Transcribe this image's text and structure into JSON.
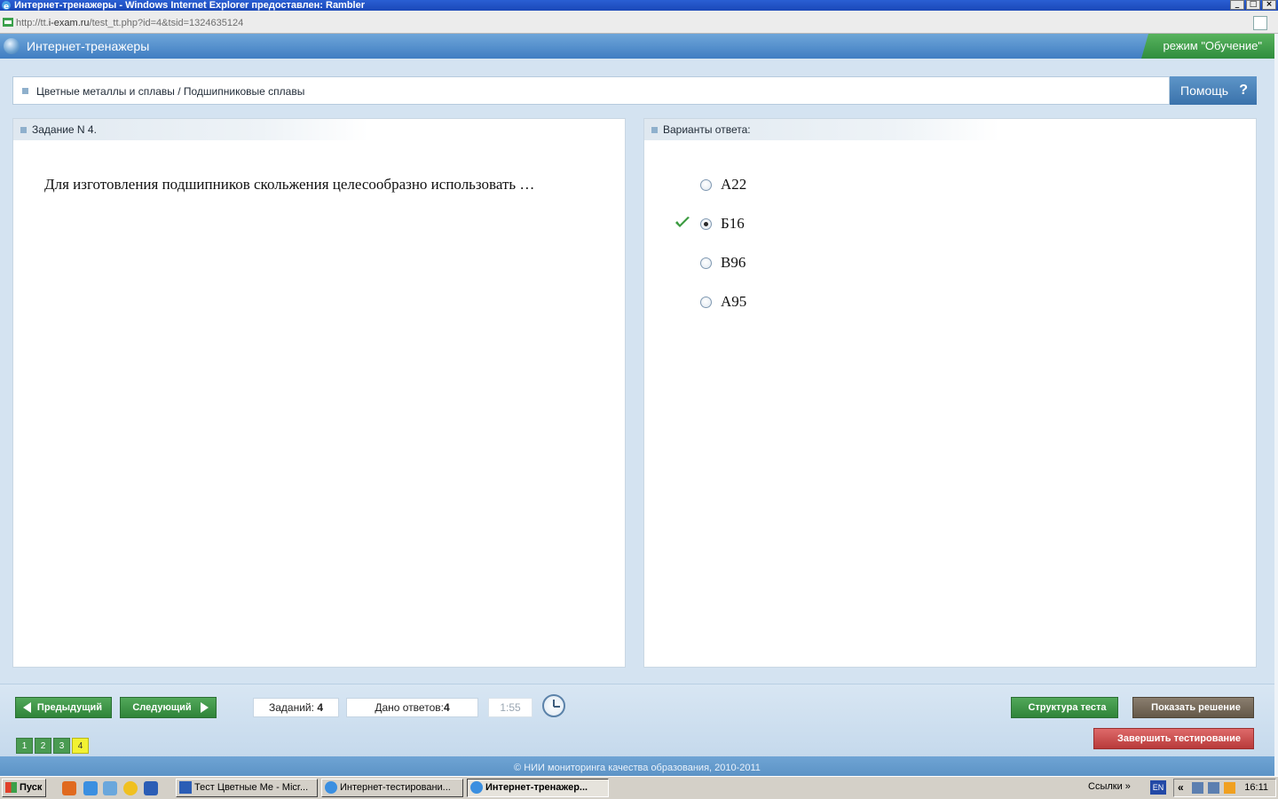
{
  "window": {
    "title": "Интернет-тренажеры - Windows Internet Explorer предоставлен: Rambler",
    "controls": [
      "_",
      "□",
      "×"
    ]
  },
  "address": {
    "url_prefix": "http://tt.",
    "url_domain": "i-exam.ru",
    "url_path": "/test_tt.php?id=4&tsid=1324635124"
  },
  "app": {
    "title": "Интернет-тренажеры",
    "mode": "режим \"Обучение\""
  },
  "breadcrumb": "Цветные металлы и сплавы / Подшипниковые сплавы",
  "help": {
    "label": "Помощь",
    "icon": "?"
  },
  "task": {
    "header": "Задание N 4.",
    "question": "Для изготовления подшипников скольжения целесообразно использовать …"
  },
  "answers": {
    "header": "Варианты ответа:",
    "options": [
      {
        "label": "А22",
        "selected": false,
        "checked": false
      },
      {
        "label": "Б16",
        "selected": true,
        "checked": true
      },
      {
        "label": "В96",
        "selected": false,
        "checked": false
      },
      {
        "label": "А95",
        "selected": false,
        "checked": false
      }
    ]
  },
  "nav": {
    "prev": "Предыдущий",
    "next": "Следующий",
    "tasks_label": "Заданий:",
    "tasks_count": "4",
    "answers_label": "Дано ответов:",
    "answers_count": "4",
    "timer": "1:55",
    "pages": [
      "1",
      "2",
      "3",
      "4"
    ],
    "active_page": "4",
    "structure_btn": "Структура теста",
    "solution_btn": "Показать решение",
    "finish_btn": "Завершить тестирование"
  },
  "footer": "© НИИ мониторинга качества образования, 2010-2011",
  "taskbar": {
    "start": "Пуск",
    "items": [
      {
        "label": "Тест Цветные Ме - Micr...",
        "pressed": false
      },
      {
        "label": "Интернет-тестировани...",
        "pressed": false
      },
      {
        "label": "Интернет-тренажер...",
        "pressed": true
      }
    ],
    "links": "Ссылки",
    "lang": "EN",
    "time": "16:11"
  },
  "colors": {
    "accent_blue": "#3f7dc2",
    "mode_green": "#2f8d3d",
    "active_page": "#f2f233",
    "finish_red": "#b83a3a"
  }
}
